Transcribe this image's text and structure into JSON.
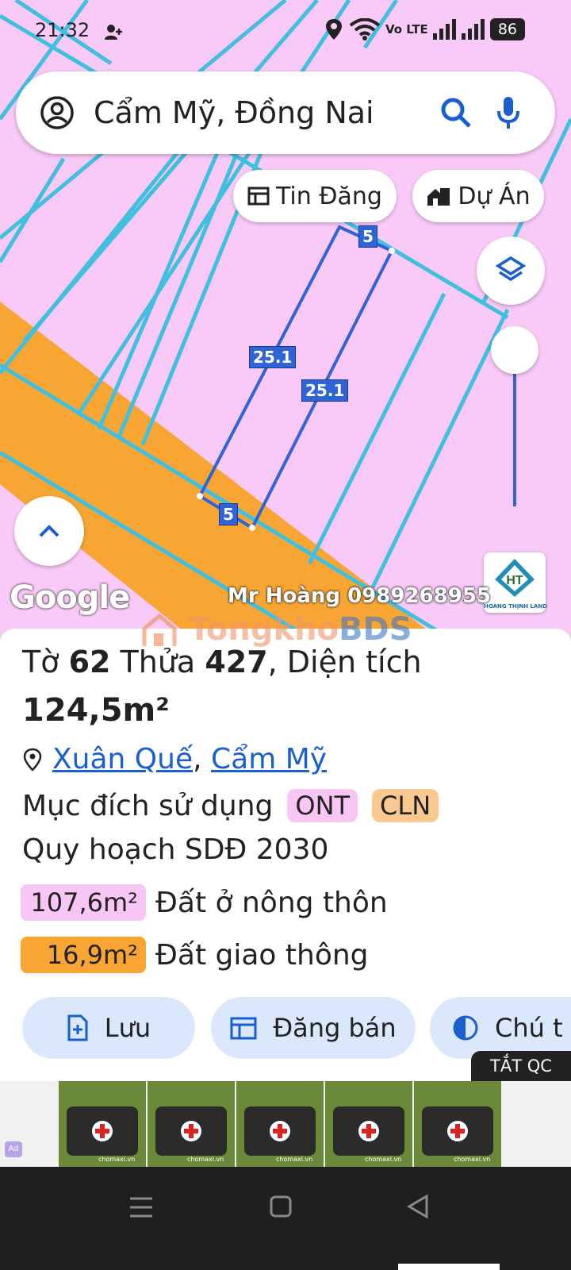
{
  "status_bar": {
    "time": "21:32",
    "network_label": "Vo LTE",
    "battery": "86"
  },
  "search": {
    "query": "Cẩm Mỹ, Đồng Nai",
    "icons": [
      "account-icon",
      "search-icon",
      "mic-icon"
    ]
  },
  "map_controls": {
    "listings_label": "Tin Đăng",
    "projects_label": "Dự Án",
    "layers_icon": "layers-icon",
    "expand_icon": "chevron-up-icon"
  },
  "map_labels": {
    "edge_top": "5",
    "edge_left": "25.1",
    "edge_right": "25.1",
    "edge_bottom": "5"
  },
  "map_overlay": {
    "google_logo": "Google",
    "contact": "Mr Hoàng 0989268955",
    "site_watermark": "TongkhoBDS",
    "agency_logo": "HOÀNG THỊNH LAND"
  },
  "parcel": {
    "sheet_label": "Tờ",
    "sheet_no": "62",
    "plot_label": "Thửa",
    "plot_no": "427",
    "area_label": ", Diện tích",
    "area": "124,5m²",
    "location": {
      "village": "Xuân Quế",
      "separator": ",",
      "commune": "Cẩm Mỹ"
    },
    "purpose_label": "Mục đích sử dụng",
    "purpose_tags": [
      "ONT",
      "CLN"
    ],
    "plan_label": "Quy hoạch SDĐ 2030",
    "plan_areas": [
      {
        "area": "107,6m²",
        "label": "Đất ở nông thôn",
        "color": "#f7c6f4"
      },
      {
        "area": "16,9m²",
        "label": "Đất giao thông",
        "color": "#f9a533"
      }
    ]
  },
  "actions": {
    "save": "Lưu",
    "post_sale": "Đăng bán",
    "note": "Chú t"
  },
  "ad": {
    "close_label": "TẮT QC",
    "thumb_caption": "chomaxi.vn"
  },
  "colors": {
    "map_residential": "#f9c9f7",
    "map_road": "#f9a533",
    "parcel_line": "#2f63d6",
    "boundary": "#3fc0e0",
    "accent": "#1a5fd0",
    "button_bg": "#dbe7fa"
  }
}
